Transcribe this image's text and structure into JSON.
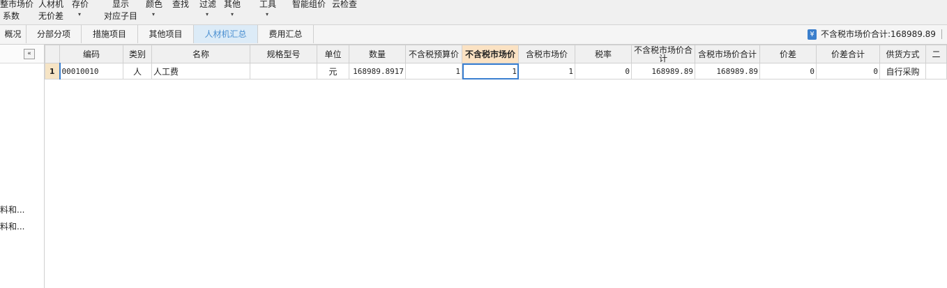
{
  "toolbar": {
    "items": [
      {
        "top": "整市场价",
        "bottom": "系数"
      },
      {
        "top": "人材机",
        "bottom": "无价差"
      },
      {
        "top": "存价",
        "bottom": "▾"
      },
      {
        "top": "显示",
        "bottom": "对应子目"
      },
      {
        "top": "颜色",
        "bottom": "▾"
      },
      {
        "top": "查找",
        "bottom": ""
      },
      {
        "top": "过滤",
        "bottom": "▾"
      },
      {
        "top": "其他",
        "bottom": "▾"
      },
      {
        "top": "工具",
        "bottom": "▾"
      },
      {
        "top": "智能组价",
        "bottom": ""
      },
      {
        "top": "云检查",
        "bottom": ""
      }
    ]
  },
  "tabs": [
    "概况",
    "分部分项",
    "措施项目",
    "其他项目",
    "人材机汇总",
    "费用汇总"
  ],
  "summary": {
    "icon": "¥",
    "label": "不含税市场价合计:168989.89"
  },
  "left_panel": {
    "collapse_label": "«",
    "items": [
      "料和...",
      "料和..."
    ]
  },
  "table": {
    "columns": [
      "编码",
      "类别",
      "名称",
      "规格型号",
      "单位",
      "数量",
      "不含税预算价",
      "不含税市场价",
      "含税市场价",
      "税率",
      "不含税市场价合计",
      "含税市场价合计",
      "价差",
      "价差合计",
      "供货方式",
      "二"
    ],
    "rows": [
      {
        "index": "1",
        "code": "00010010",
        "category": "人",
        "name": "人工费",
        "spec": "",
        "unit": "元",
        "quantity": "168989.8917",
        "budget_price": "1",
        "market_price": "1",
        "tax_market_price": "1",
        "tax_rate": "0",
        "market_total": "168989.89",
        "tax_market_total": "168989.89",
        "price_diff": "0",
        "price_diff_total": "0",
        "supply": "自行采购",
        "extra": ""
      }
    ]
  }
}
